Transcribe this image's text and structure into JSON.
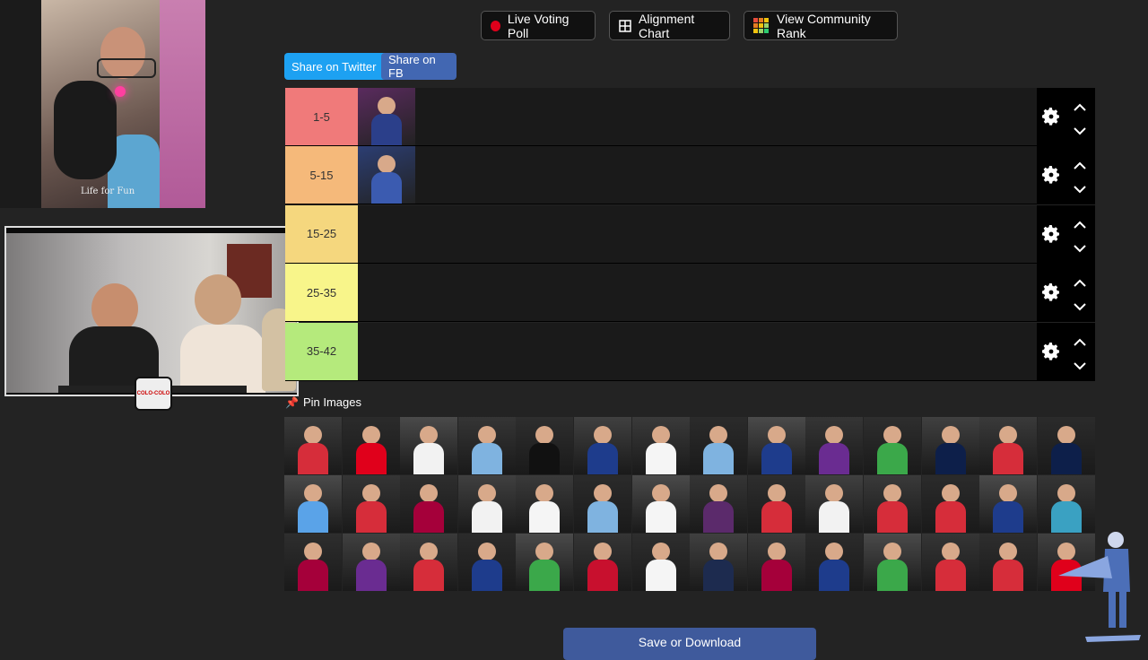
{
  "toolbar": {
    "live_poll": "Live Voting Poll",
    "alignment": "Alignment Chart",
    "community": "View Community Rank"
  },
  "share": {
    "twitter": "Share on Twitter",
    "fb": "Share on FB"
  },
  "tiers": [
    {
      "label": "1-5",
      "color": "#f07a7a",
      "images": 1
    },
    {
      "label": "5-15",
      "color": "#f5b97a",
      "images": 1
    },
    {
      "label": "15-25",
      "color": "#f5d77e",
      "images": 0
    },
    {
      "label": "25-35",
      "color": "#f8f58a",
      "images": 0
    },
    {
      "label": "35-42",
      "color": "#b5ea7c",
      "images": 0
    }
  ],
  "pin": {
    "label": "Pin Images"
  },
  "pool_count": 42,
  "save": {
    "label": "Save or Download"
  },
  "overlay": {
    "cam_caption": "Life for Fun",
    "badge": "COLO-COLO"
  },
  "colors": {
    "twitter": "#1da1f2",
    "fb": "#4267b2",
    "accent_red": "#e0001b"
  }
}
